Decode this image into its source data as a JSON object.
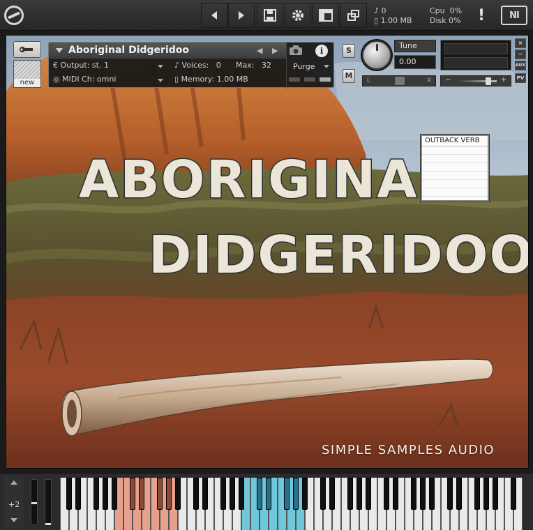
{
  "toolbar": {
    "logo_icon": "kontakt-logo-icon",
    "buttons": [
      {
        "name": "nav-back-button",
        "icon": "chevron-left-icon"
      },
      {
        "name": "nav-forward-button",
        "icon": "chevron-right-icon"
      },
      {
        "name": "save-button",
        "icon": "floppy-disk-icon"
      },
      {
        "name": "options-button",
        "icon": "gear-icon"
      },
      {
        "name": "view-button",
        "icon": "layout-icon"
      },
      {
        "name": "rack-button",
        "icon": "windows-icon"
      }
    ],
    "stats": {
      "voices": "0",
      "memory": "1.00 MB",
      "cpu_label": "Cpu",
      "cpu_value": "0%",
      "disk_label": "Disk",
      "disk_value": "0%"
    },
    "warning": "!",
    "ni_logo": "NI"
  },
  "instrument": {
    "name": "Aboriginal Didgeridoo",
    "new_tile_label": "new",
    "output_label": "Output:",
    "output_value": "st. 1",
    "voices_label": "Voices:",
    "voices_value": "0",
    "max_label": "Max:",
    "max_value": "32",
    "purge_label": "Purge",
    "midi_label": "MIDI Ch:",
    "midi_value": "omni",
    "memory_label": "Memory:",
    "memory_value": "1.00 MB",
    "solo": "S",
    "mute": "M",
    "tune_label": "Tune",
    "tune_value": "0.00",
    "pan_left": "L",
    "pan_right": "R",
    "vol_minus": "−",
    "vol_plus": "+",
    "close": "×",
    "minimize": "−",
    "aux": "AUX",
    "pv": "PV"
  },
  "reverb_panel": {
    "title": "OUTBACK VERB"
  },
  "artwork": {
    "title_line1": "ABORIGINAL",
    "title_line2": "DIDGERIDOO",
    "brand": "SIMPLE SAMPLES AUDIO"
  },
  "keyboard": {
    "octave": "+2",
    "keyswitch_color": "#e6a08b",
    "playable_color": "#6fc7dc"
  }
}
